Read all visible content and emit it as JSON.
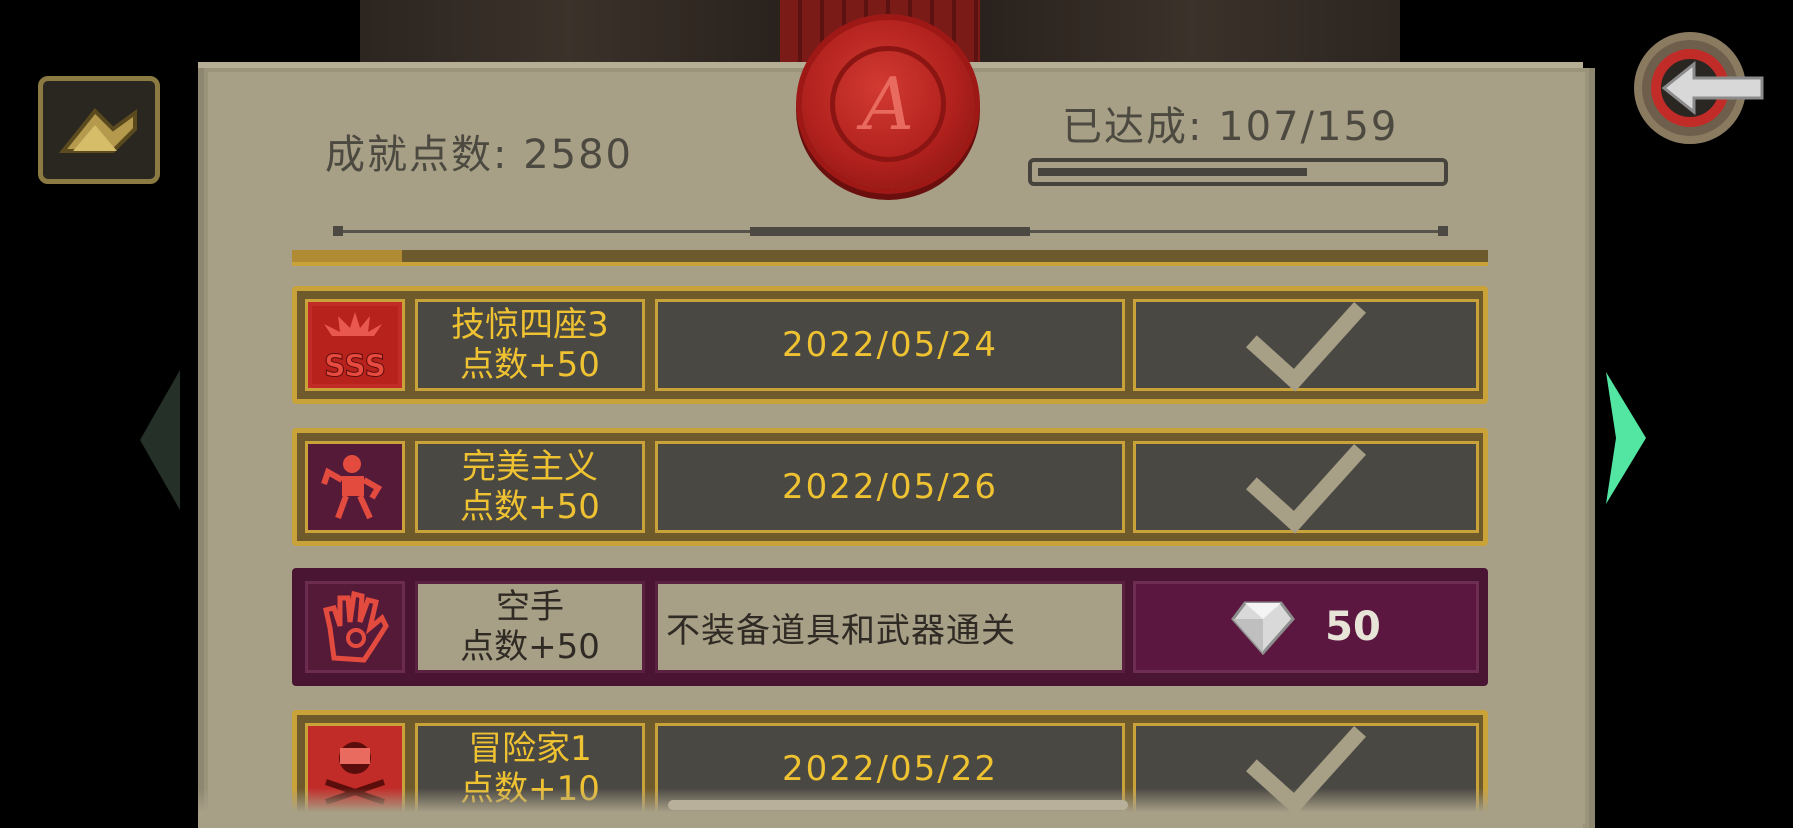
{
  "header": {
    "points_label": "成就点数: 2580",
    "achieved_label": "已达成: 107/159",
    "achieved_count": 107,
    "achieved_total": 159,
    "seal_letter": "A"
  },
  "achievements": [
    {
      "icon": "sss-rank-icon",
      "name": "技惊四座3",
      "points": "点数+50",
      "date": "2022/05/24",
      "status": "completed"
    },
    {
      "icon": "skeleton-pose-icon",
      "name": "完美主义",
      "points": "点数+50",
      "date": "2022/05/26",
      "status": "completed"
    },
    {
      "icon": "open-hand-icon",
      "name": "空手",
      "points": "点数+50",
      "description": "不装备道具和武器通关",
      "reward": "50",
      "status": "locked"
    },
    {
      "icon": "skull-crossbones-icon",
      "name": "冒险家1",
      "points": "点数+10",
      "date": "2022/05/22",
      "status": "completed"
    }
  ],
  "colors": {
    "gold": "#efc232",
    "parchment": "#a79f86",
    "dark_cell": "#4a4843",
    "locked": "#5b1740",
    "seal": "#b1211d",
    "nav_right": "#53e6a2"
  }
}
